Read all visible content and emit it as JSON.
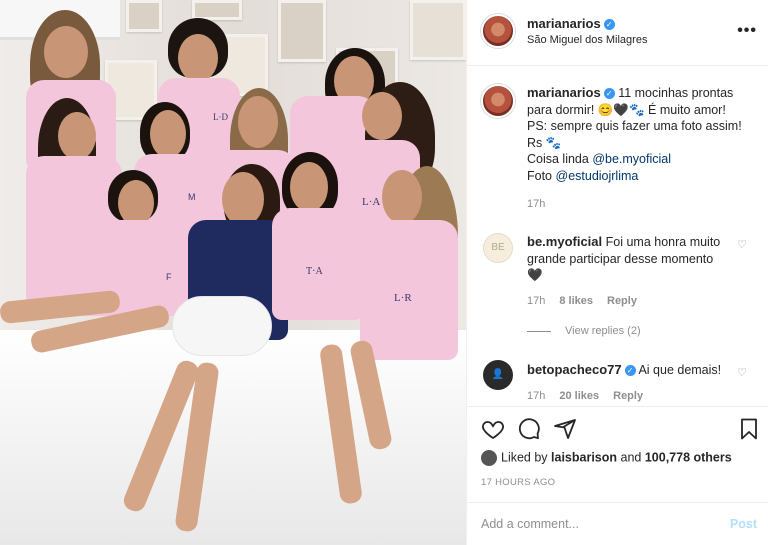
{
  "post": {
    "username": "marianarios",
    "location": "São Miguel dos Milagres",
    "more_label": "•••"
  },
  "caption": {
    "username": "marianarios",
    "lines": [
      "11 mocinhas prontas",
      "para dormir! 😊🖤🐾 É muito amor!",
      "PS: sempre quis fazer uma foto assim!",
      "Rs 🐾",
      "Coisa linda ",
      "Foto "
    ],
    "mention1": "@be.myoficial",
    "mention2": "@estudiojrlima",
    "time": "17h"
  },
  "comments": [
    {
      "username": "be.myoficial",
      "text_line1": "Foi uma honra muito",
      "text_line2": "grande participar desse momento",
      "text_line3": "🖤",
      "time": "17h",
      "likes": "8 likes",
      "reply": "Reply",
      "view_replies": "View replies (2)",
      "avatar_text": "BE"
    },
    {
      "username": "betopacheco77",
      "text": "Ai que demais!",
      "time": "17h",
      "likes": "20 likes",
      "reply": "Reply"
    }
  ],
  "likes_row": {
    "prefix": "Liked by ",
    "liker": "laisbarison",
    "middle": " and ",
    "count": "100,778 others"
  },
  "timestamp": "17 HOURS AGO",
  "add_comment": {
    "placeholder": "Add a comment...",
    "post_label": "Post"
  },
  "icons": [
    "heart-icon",
    "comment-icon",
    "share-icon",
    "bookmark-icon",
    "verified-icon"
  ],
  "colors": {
    "link": "#00376b",
    "verified": "#3897f0",
    "muted": "#8e8e8e",
    "post_disabled": "#b2dffc"
  },
  "photo_shirt_initials": [
    "L·D",
    "T·A",
    "L·R",
    "M",
    "F",
    "L·A"
  ]
}
